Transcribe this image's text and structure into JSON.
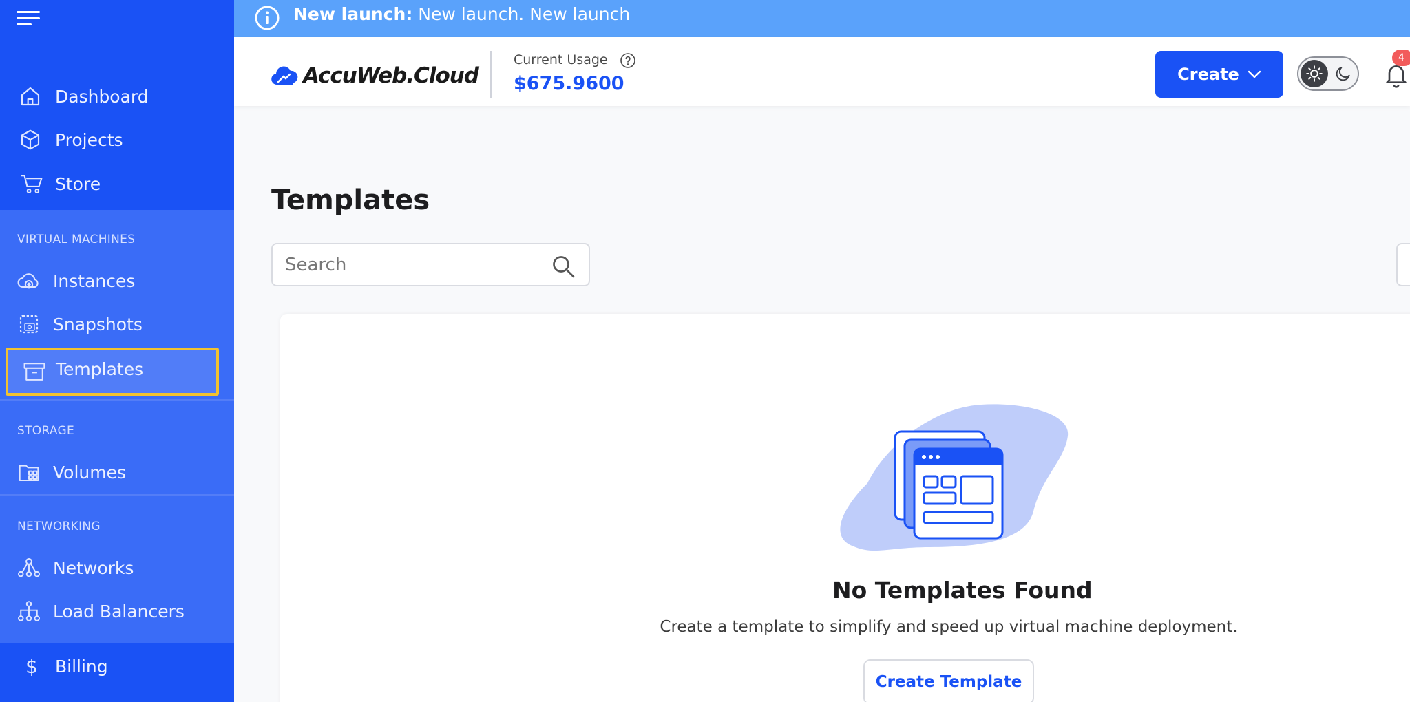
{
  "banner": {
    "label_bold": "New launch:",
    "label_rest": " New launch. New launch",
    "bg_color": "#5aa2fb"
  },
  "sidebar": {
    "bg_color": "#1a52f5",
    "items_top": [
      {
        "label": "Dashboard",
        "icon": "home-icon"
      },
      {
        "label": "Projects",
        "icon": "cube-icon"
      },
      {
        "label": "Store",
        "icon": "cart-icon"
      }
    ],
    "sections": [
      {
        "title": "VIRTUAL MACHINES",
        "items": [
          {
            "label": "Instances",
            "icon": "cloud-plus-icon"
          },
          {
            "label": "Snapshots",
            "icon": "camera-icon"
          },
          {
            "label": "Templates",
            "icon": "archive-box-icon",
            "active": true
          }
        ]
      },
      {
        "title": "STORAGE",
        "items": [
          {
            "label": "Volumes",
            "icon": "folder-grid-icon"
          }
        ]
      },
      {
        "title": "NETWORKING",
        "items": [
          {
            "label": "Networks",
            "icon": "network-icon"
          },
          {
            "label": "Load Balancers",
            "icon": "sitemap-icon"
          }
        ]
      }
    ],
    "items_bottom": [
      {
        "label": "Billing",
        "icon": "dollar-icon"
      }
    ]
  },
  "header": {
    "logo_text": "AccuWeb.Cloud",
    "usage_label": "Current Usage",
    "usage_value": "$675.9600",
    "create_label": "Create",
    "notification_count": "4",
    "accent_color": "#1a52f5"
  },
  "main": {
    "page_title": "Templates",
    "search_placeholder": "Search",
    "empty_title": "No Templates Found",
    "empty_description": "Create a template to simplify and speed up virtual machine deployment.",
    "create_template_label": "Create Template"
  }
}
